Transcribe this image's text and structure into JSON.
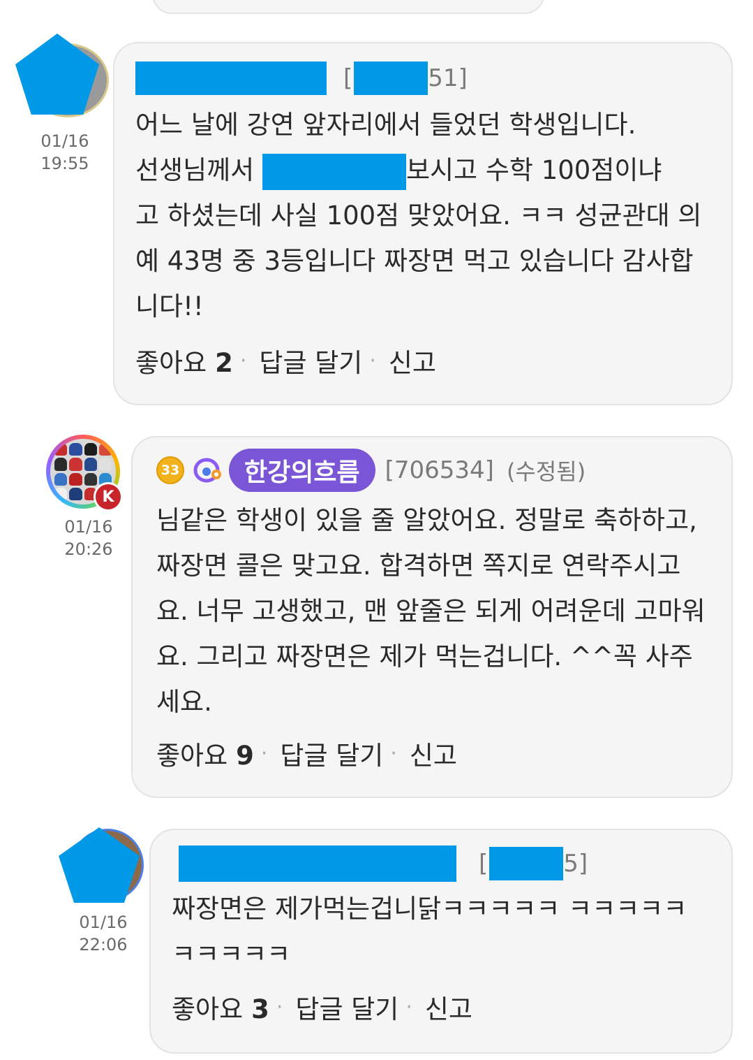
{
  "comments": [
    {
      "meta_bracket_open": "[",
      "meta_id_tail": "51]",
      "date": "01/16",
      "time": "19:55",
      "body": "어느 날에 강연 앞자리에서 들었던 학생입니다.",
      "body_line2_pre": "선생님께서 ",
      "body_line2_post": "보시고 수학 100점이냐",
      "body_rest": "고 하셨는데 사실 100점 맞았어요. ㅋㅋ 성균관대 의예 43명 중 3등입니다 짜장면 먹고 있습니다 감사합니다!!",
      "like_label": "좋아요",
      "like_count": "2",
      "reply_label": "답글 달기",
      "report_label": "신고"
    },
    {
      "level": "33",
      "nickname": "한강의흐름",
      "member_id": "[706534]",
      "edited": "(수정됨)",
      "avatar_badge": "K",
      "date": "01/16",
      "time": "20:26",
      "body": "님같은 학생이 있을 줄 알았어요. 정말로 축하하고, 짜장면 콜은 맞고요. 합격하면 쪽지로 연락주시고요. 너무 고생했고, 맨 앞줄은 되게 어려운데 고마워요. 그리고 짜장면은 제가 먹는겁니다. ^^꼭 사주세요.",
      "like_label": "좋아요",
      "like_count": "9",
      "reply_label": "답글 달기",
      "report_label": "신고"
    },
    {
      "meta_bracket_open": "[",
      "meta_id_tail": "5]",
      "date": "01/16",
      "time": "22:06",
      "body": "짜장면은 제가먹는겁니닭ㅋㅋㅋㅋㅋ ㅋㅋㅋㅋㅋ ㅋㅋㅋㅋㅋ",
      "like_label": "좋아요",
      "like_count": "3",
      "reply_label": "답글 달기",
      "report_label": "신고"
    }
  ],
  "colors": {
    "redaction": "#0099e8",
    "nickname_pill": "#7a55d6",
    "level_badge": "#f2b21c",
    "k_badge": "#c8242c"
  }
}
